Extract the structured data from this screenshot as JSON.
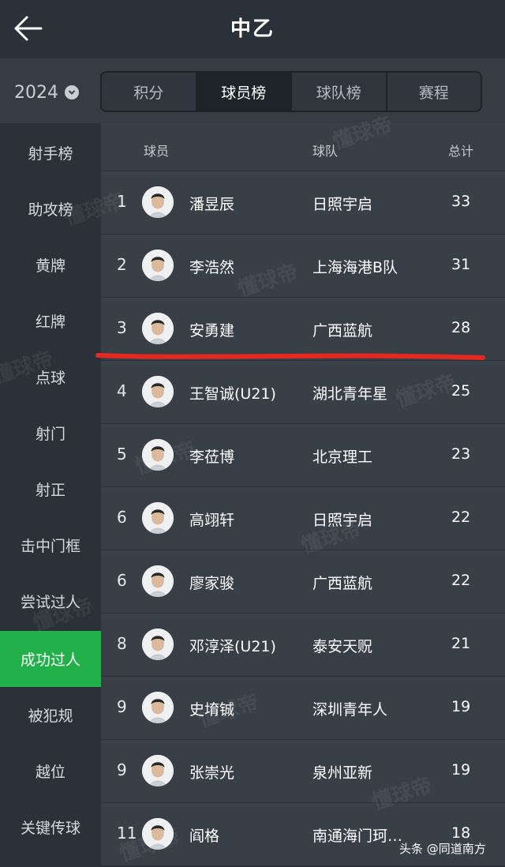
{
  "header": {
    "title": "中乙"
  },
  "year": {
    "value": "2024"
  },
  "tabs": [
    {
      "label": "积分"
    },
    {
      "label": "球员榜"
    },
    {
      "label": "球队榜"
    },
    {
      "label": "赛程"
    }
  ],
  "sidebar": {
    "items": [
      {
        "label": "射手榜"
      },
      {
        "label": "助攻榜"
      },
      {
        "label": "黄牌"
      },
      {
        "label": "红牌"
      },
      {
        "label": "点球"
      },
      {
        "label": "射门"
      },
      {
        "label": "射正"
      },
      {
        "label": "击中门框"
      },
      {
        "label": "尝试过人"
      },
      {
        "label": "成功过人"
      },
      {
        "label": "被犯规"
      },
      {
        "label": "越位"
      },
      {
        "label": "关键传球"
      }
    ]
  },
  "table": {
    "columns": {
      "player": "球员",
      "team": "球队",
      "total": "总计"
    },
    "rows": [
      {
        "rank": "1",
        "name": "潘昱辰",
        "team": "日照宇启",
        "total": "33"
      },
      {
        "rank": "2",
        "name": "李浩然",
        "team": "上海海港B队",
        "total": "31"
      },
      {
        "rank": "3",
        "name": "安勇建",
        "team": "广西蓝航",
        "total": "28"
      },
      {
        "rank": "4",
        "name": "王智诚(U21)",
        "team": "湖北青年星",
        "total": "25"
      },
      {
        "rank": "5",
        "name": "李莅博",
        "team": "北京理工",
        "total": "23"
      },
      {
        "rank": "6",
        "name": "高翊轩",
        "team": "日照宇启",
        "total": "22"
      },
      {
        "rank": "6",
        "name": "廖家骏",
        "team": "广西蓝航",
        "total": "22"
      },
      {
        "rank": "8",
        "name": "邓淳泽(U21)",
        "team": "泰安天贶",
        "total": "21"
      },
      {
        "rank": "9",
        "name": "史堉铖",
        "team": "深圳青年人",
        "total": "19"
      },
      {
        "rank": "9",
        "name": "张崇光",
        "team": "泉州亚新",
        "total": "19"
      },
      {
        "rank": "11",
        "name": "阎格",
        "team": "南通海门珂…",
        "total": "18"
      }
    ]
  },
  "watermark": "懂球帝",
  "credit": "头条 @同道南方",
  "colors": {
    "accent": "#22b04b",
    "highlight_line": "#e5291f"
  }
}
